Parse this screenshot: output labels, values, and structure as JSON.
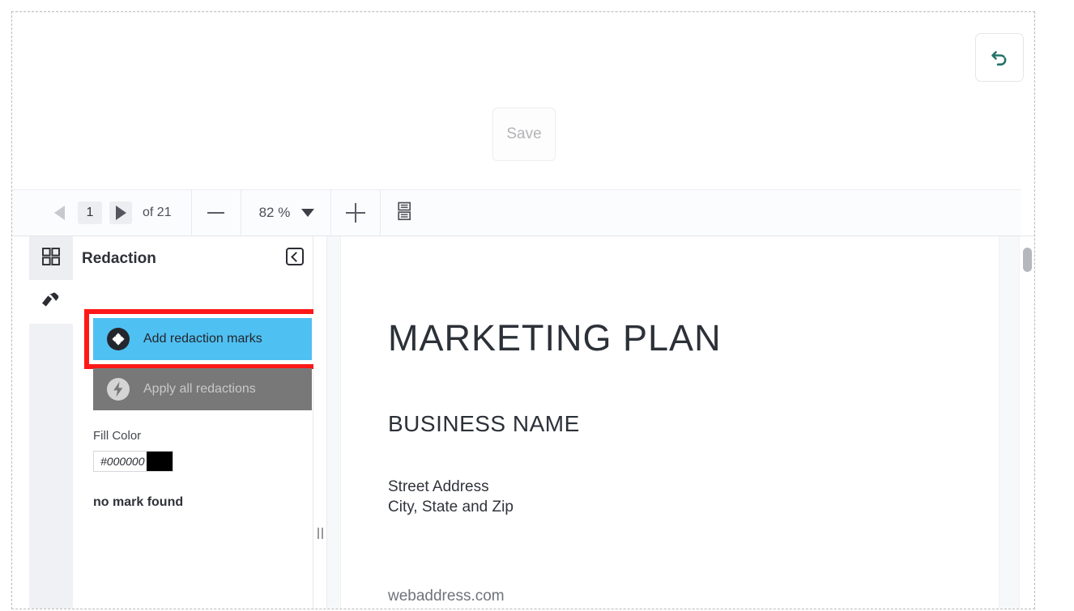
{
  "header": {
    "undo_icon": "undo-arrow-icon",
    "save_label": "Save"
  },
  "toolbar": {
    "prev_page_icon": "triangle-left-icon",
    "next_page_icon": "triangle-right-icon",
    "page_number_value": "1",
    "page_count_label": "of 21",
    "zoom_out_icon": "minus-icon",
    "zoom_value": "82 %",
    "zoom_dropdown_icon": "chevron-down-icon",
    "zoom_in_icon": "plus-icon",
    "page_layout_icon": "page-layout-icon"
  },
  "rail": {
    "items": [
      {
        "name": "thumbnails",
        "icon": "grid-squares-icon",
        "active": true
      },
      {
        "name": "annotate",
        "icon": "eraser-pencil-icon",
        "active": false
      }
    ]
  },
  "panel": {
    "title": "Redaction",
    "collapse_icon": "chevron-left-icon",
    "add_marks_label": "Add redaction marks",
    "add_marks_icon": "plus-circle-icon",
    "apply_all_label": "Apply all redactions",
    "apply_all_icon": "lightning-bolt-icon",
    "fill_color_label": "Fill Color",
    "fill_color_value": "#000000",
    "fill_color_swatch": "#000000",
    "status_message": "no mark found",
    "highlight_color": "#ff1818",
    "add_marks_color": "#4fc0f2",
    "apply_all_color": "#787878"
  },
  "document": {
    "title": "MARKETING PLAN",
    "subtitle": "BUSINESS NAME",
    "address_line1": "Street Address",
    "address_line2": "City, State and Zip",
    "weblink": "webaddress.com"
  }
}
